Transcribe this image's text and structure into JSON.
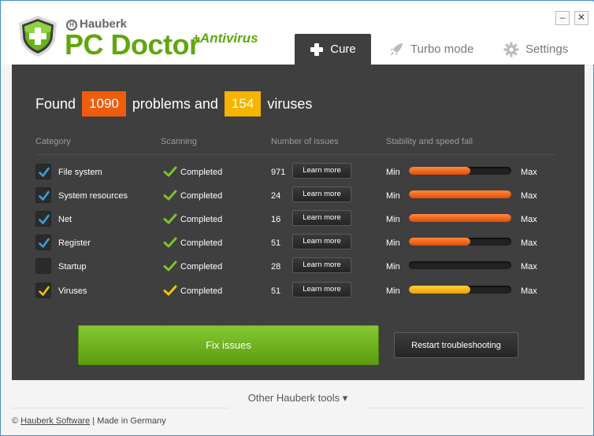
{
  "brand": {
    "company": "Hauberk",
    "product": "PC Doctor",
    "addon": "+Antivirus"
  },
  "window_controls": {
    "minimize": "–",
    "close": "✕"
  },
  "tabs": [
    {
      "label": "Cure",
      "icon": "plus-icon",
      "active": true
    },
    {
      "label": "Turbo mode",
      "icon": "rocket-icon",
      "active": false
    },
    {
      "label": "Settings",
      "icon": "gear-icon",
      "active": false
    }
  ],
  "summary": {
    "prefix": "Found",
    "problems": "1090",
    "middle": "problems and",
    "viruses": "154",
    "suffix": "viruses"
  },
  "columns": {
    "category": "Category",
    "scanning": "Scanning",
    "issues": "Number of issues",
    "stability": "Stability and speed fall"
  },
  "rows": [
    {
      "category": "File system",
      "checked": true,
      "check_color": "#3aa0e0",
      "status": "Completed",
      "status_color": "#7ec229",
      "issues": "971",
      "button": "Learn more",
      "min": "Min",
      "max": "Max",
      "level": 0.6,
      "bar": "orange"
    },
    {
      "category": "System resources",
      "checked": true,
      "check_color": "#3aa0e0",
      "status": "Completed",
      "status_color": "#7ec229",
      "issues": "24",
      "button": "Learn more",
      "min": "Min",
      "max": "Max",
      "level": 1.0,
      "bar": "orange"
    },
    {
      "category": "Net",
      "checked": true,
      "check_color": "#3aa0e0",
      "status": "Completed",
      "status_color": "#7ec229",
      "issues": "16",
      "button": "Learn more",
      "min": "Min",
      "max": "Max",
      "level": 1.0,
      "bar": "orange"
    },
    {
      "category": "Register",
      "checked": true,
      "check_color": "#3aa0e0",
      "status": "Completed",
      "status_color": "#7ec229",
      "issues": "51",
      "button": "Learn more",
      "min": "Min",
      "max": "Max",
      "level": 0.6,
      "bar": "orange"
    },
    {
      "category": "Startup",
      "checked": false,
      "check_color": "#3aa0e0",
      "status": "Completed",
      "status_color": "#7ec229",
      "issues": "28",
      "button": "Learn more",
      "min": "Min",
      "max": "Max",
      "level": 0.0,
      "bar": "orange"
    },
    {
      "category": "Viruses",
      "checked": true,
      "check_color": "#f5c400",
      "status": "Completed",
      "status_color": "#f5c400",
      "issues": "51",
      "button": "Learn more",
      "min": "Min",
      "max": "Max",
      "level": 0.6,
      "bar": "yellow"
    }
  ],
  "colors": {
    "accent_green": "#5fa70b",
    "badge_orange": "#f15c0c",
    "badge_yellow": "#f6b300",
    "panel": "#3f3f3f"
  },
  "actions": {
    "fix": "Fix issues",
    "restart": "Restart troubleshooting"
  },
  "other_tools": "Other Hauberk tools ▾",
  "footer": {
    "copyright": "©",
    "company_link": "Hauberk Software",
    "separator": "|",
    "made_in": "Made in Germany"
  }
}
